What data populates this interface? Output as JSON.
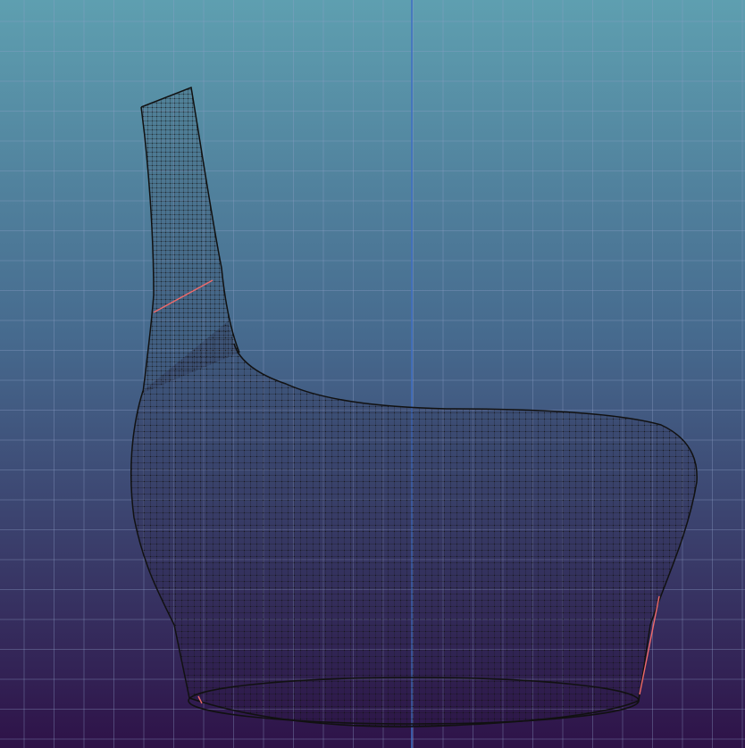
{
  "viewport": {
    "background_top": "#5e9fb0",
    "background_bottom": "#2e1248",
    "grid_color": "#8fa0c8",
    "axis_color": "#3f6fc4",
    "mesh_color": "#111111",
    "seam_color": "#f06a6a"
  },
  "model": {
    "object": "one-shoulder-top",
    "display_mode": "wireframe-mesh",
    "seams_visible": true
  }
}
